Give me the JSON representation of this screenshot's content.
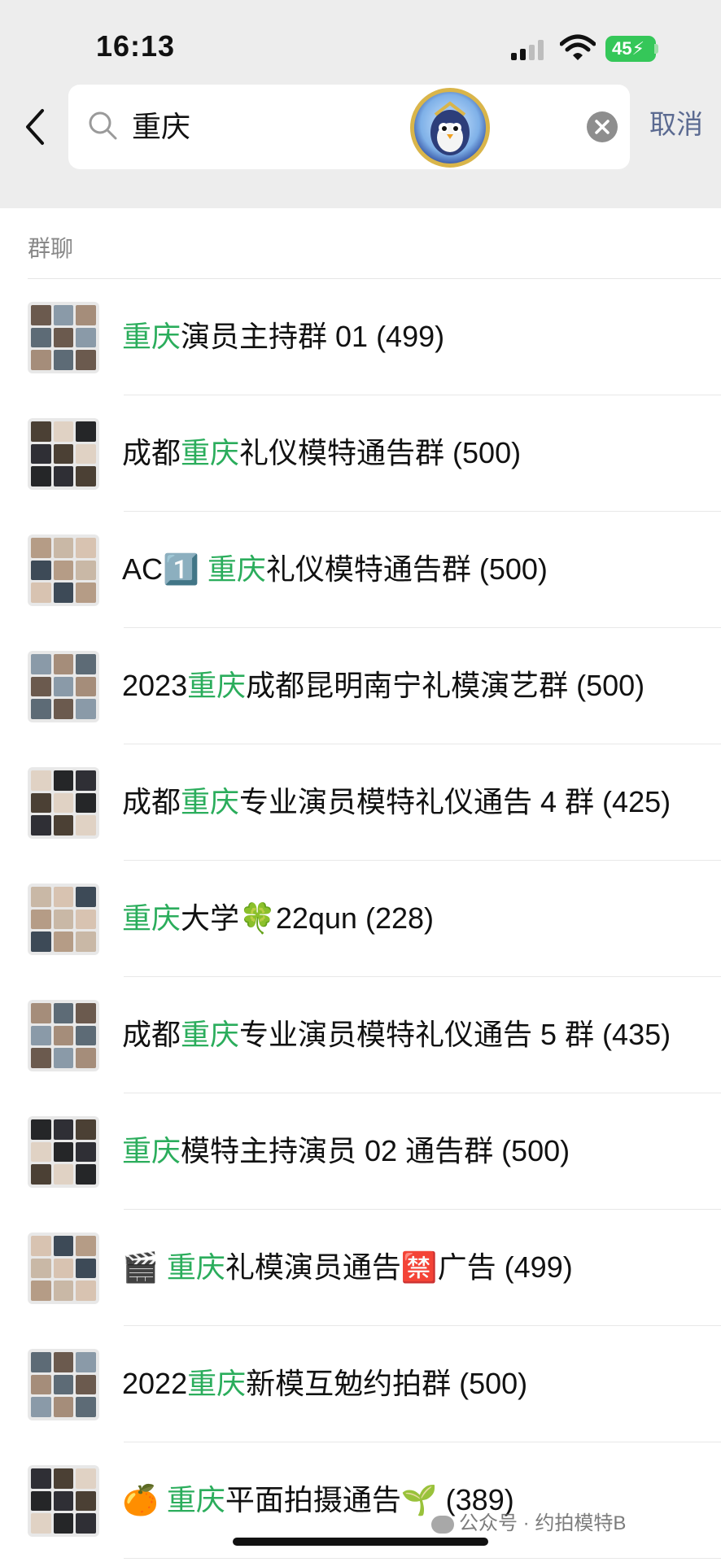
{
  "status_bar": {
    "time": "16:13",
    "battery": "45"
  },
  "search": {
    "query": "重庆",
    "cancel": "取消"
  },
  "section": {
    "title": "群聊"
  },
  "groups": [
    {
      "pre": "",
      "hl": "重庆",
      "post": "演员主持群 01 (499)"
    },
    {
      "pre": "成都",
      "hl": "重庆",
      "post": "礼仪模特通告群 (500)"
    },
    {
      "pre": "AC1️⃣ ",
      "hl": "重庆",
      "post": "礼仪模特通告群 (500)"
    },
    {
      "pre": "2023",
      "hl": "重庆",
      "post": "成都昆明南宁礼模演艺群 (500)"
    },
    {
      "pre": "成都",
      "hl": "重庆",
      "post": "专业演员模特礼仪通告 4 群 (425)"
    },
    {
      "pre": "",
      "hl": "重庆",
      "post": "大学🍀22qun (228)"
    },
    {
      "pre": "成都",
      "hl": "重庆",
      "post": "专业演员模特礼仪通告 5 群 (435)"
    },
    {
      "pre": "",
      "hl": "重庆",
      "post": "模特主持演员 02 通告群 (500)"
    },
    {
      "pre": "🎬 ",
      "hl": "重庆",
      "post": "礼模演员通告🈲广告 (499)"
    },
    {
      "pre": "2022",
      "hl": "重庆",
      "post": "新模互勉约拍群 (500)"
    },
    {
      "pre": "🍊 ",
      "hl": "重庆",
      "post": "平面拍摄通告🌱 (389)"
    }
  ],
  "watermark": {
    "text": "公众号 · 约拍模特B"
  },
  "colors": {
    "highlight": "#2bad5c",
    "cancel": "#5b6a91",
    "header_bg": "#ededed"
  }
}
